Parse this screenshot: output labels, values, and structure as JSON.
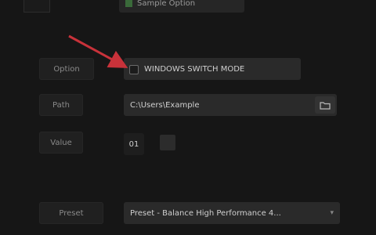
{
  "top_option_label": "Sample Option",
  "row1": {
    "label": "Option",
    "checkbox_text": "WINDOWS SWITCH MODE"
  },
  "row2": {
    "label": "Path",
    "value": "C:\\Users\\Example"
  },
  "row3": {
    "label": "Value",
    "value": "01"
  },
  "row4": {
    "label": "Preset",
    "selected": "Preset - Balance High Performance 4..."
  },
  "colors": {
    "background": "#161616",
    "arrow": "#c8323a",
    "check_accent": "#3a6a3a"
  }
}
